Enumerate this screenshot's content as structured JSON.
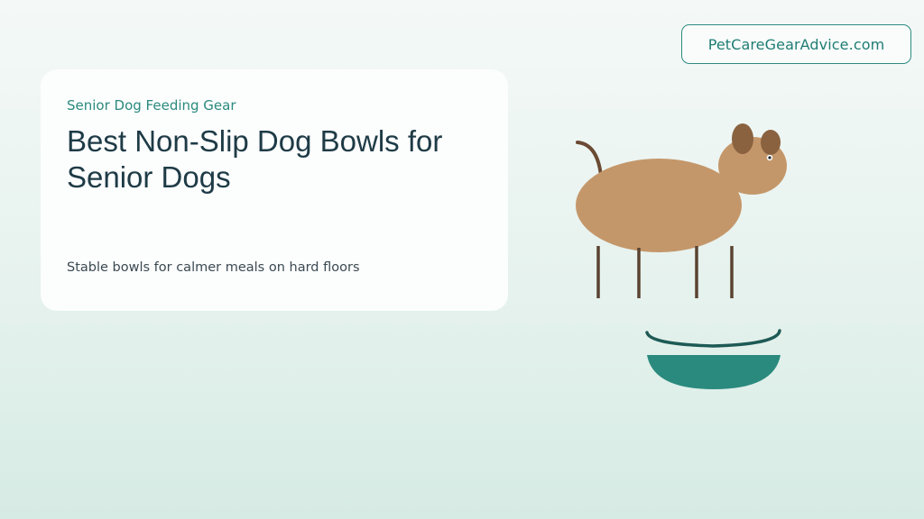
{
  "site": {
    "name": "PetCareGearAdvice.com"
  },
  "hero": {
    "kicker": "Senior Dog Feeding Gear",
    "title": "Best Non-Slip Dog Bowls for Senior Dogs",
    "subtitle": "Stable bowls for calmer meals on hard floors"
  },
  "illustration": {
    "subject": "dog-standing-over-bowl",
    "colors": {
      "dog_body": "#c4976a",
      "dog_ears": "#8a6240",
      "dog_legs": "#5a4330",
      "bowl": "#2b8a7e",
      "bowl_rim": "#1e5a55"
    }
  },
  "theme": {
    "accent": "#2b8a7e",
    "text_dark": "#1e3b46",
    "background": "#e6f2ee"
  }
}
